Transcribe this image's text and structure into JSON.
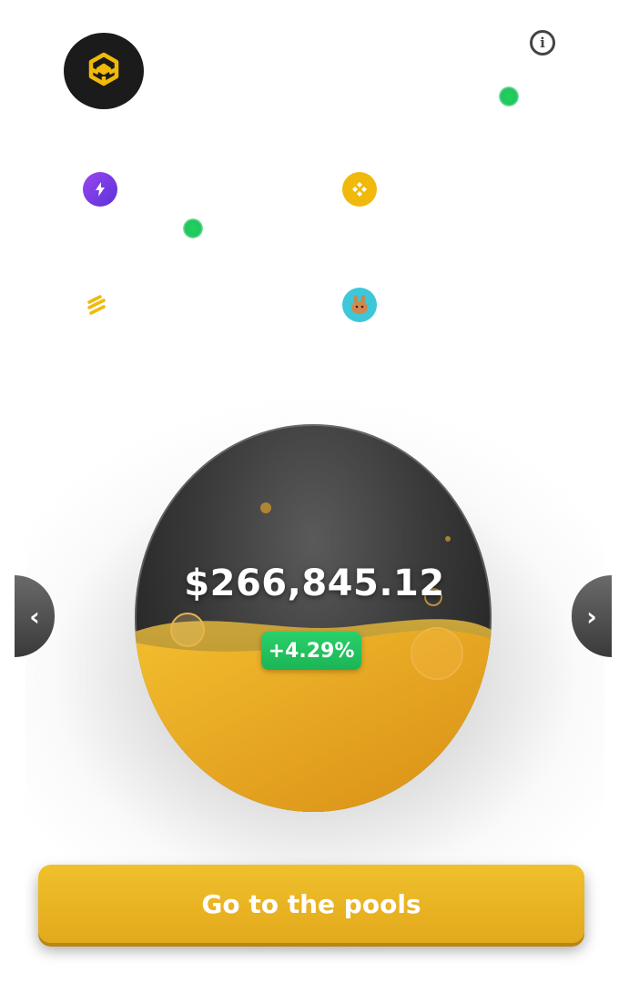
{
  "header": {
    "brand_icon": "binance-logo-icon",
    "info_icon": "info-icon",
    "info_label": "i"
  },
  "tokens": [
    {
      "name": "lightning-token-icon",
      "color": "#7b3fe4"
    },
    {
      "name": "bnb-token-icon",
      "color": "#f0b90b"
    },
    {
      "name": "stacked-lines-token-icon",
      "color": "#f0b90b"
    },
    {
      "name": "pancakeswap-token-icon",
      "color": "#3ec7d8"
    }
  ],
  "pool": {
    "total_value": "$266,845.12",
    "change": "+4.29%",
    "fill_level": 0.5
  },
  "navigation": {
    "prev_icon": "chevron-left-icon",
    "prev_label": "‹",
    "next_icon": "chevron-right-icon",
    "next_label": "›"
  },
  "cta": {
    "label": "Go to the pools"
  },
  "colors": {
    "accent": "#f0b90b",
    "positive": "#22c55e",
    "dark": "#1b1b1b"
  }
}
